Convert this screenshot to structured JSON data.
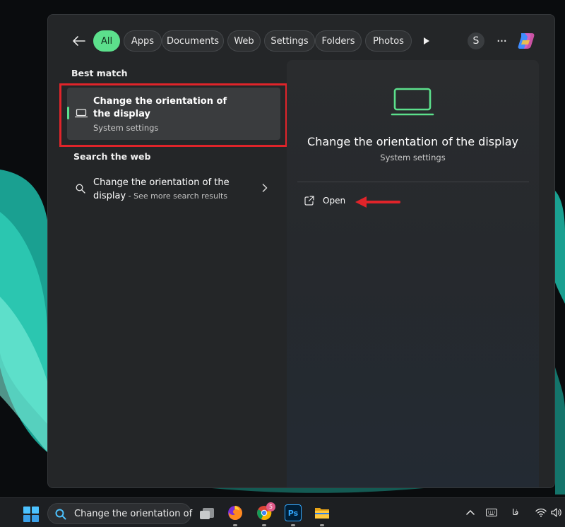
{
  "filters": {
    "back_icon": "arrow-left-icon",
    "chips": [
      {
        "label": "All",
        "active": true
      },
      {
        "label": "Apps",
        "active": false
      },
      {
        "label": "Documents",
        "active": false
      },
      {
        "label": "Web",
        "active": false
      },
      {
        "label": "Settings",
        "active": false
      },
      {
        "label": "Folders",
        "active": false
      },
      {
        "label": "Photos",
        "active": false
      }
    ],
    "avatar_letter": "S",
    "more_label": "···"
  },
  "best_match": {
    "heading": "Best match",
    "title": "Change the orientation of the display",
    "subtitle": "System settings",
    "icon": "laptop-icon"
  },
  "web": {
    "heading": "Search the web",
    "line1": "Change the orientation of the",
    "line2": "display",
    "hint": " - See more search results"
  },
  "detail": {
    "title": "Change the orientation of the display",
    "subtitle": "System settings",
    "open_label": "Open",
    "icon": "laptop-icon"
  },
  "taskbar": {
    "search_text": "Change the orientation of",
    "apps": [
      "task-view-icon",
      "firefox-icon",
      "chrome-icon",
      "photoshop-icon",
      "file-explorer-icon"
    ],
    "chrome_badge": "5",
    "photoshop_label": "Ps",
    "lang": "فا"
  },
  "colors": {
    "accent": "#5ce08c",
    "highlight_outline": "#e0242a",
    "pane_bg": "#242628"
  }
}
